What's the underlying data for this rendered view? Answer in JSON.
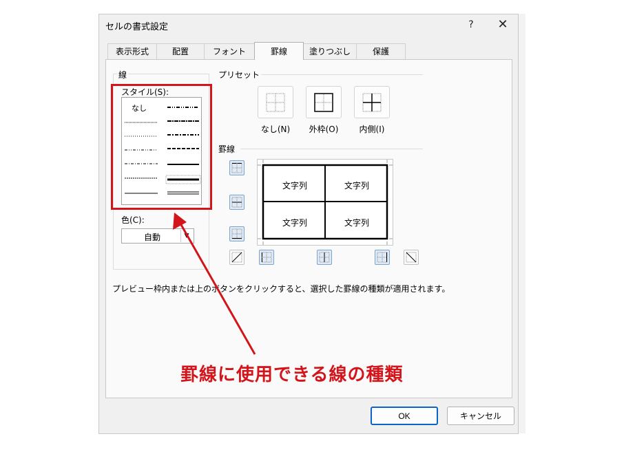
{
  "dialog": {
    "title": "セルの書式設定",
    "help": "?",
    "close": "✕"
  },
  "tabs": [
    {
      "label": "表示形式"
    },
    {
      "label": "配置"
    },
    {
      "label": "フォント"
    },
    {
      "label": "罫線",
      "active": true
    },
    {
      "label": "塗りつぶし"
    },
    {
      "label": "保護"
    }
  ],
  "line_group": {
    "title": "線",
    "style_label": "スタイル(S):",
    "none_style": "なし",
    "color_label": "色(C):",
    "color_value": "自動"
  },
  "presets": {
    "title": "プリセット",
    "none_label": "なし(N)",
    "outline_label": "外枠(O)",
    "inside_label": "内側(I)"
  },
  "border": {
    "title": "罫線",
    "cells": [
      "文字列",
      "文字列",
      "文字列",
      "文字列"
    ]
  },
  "instruction": "プレビュー枠内または上のボタンをクリックすると、選択した罫線の種類が適用されます。",
  "annotation": "罫線に使用できる線の種類",
  "buttons": {
    "ok": "OK",
    "cancel": "キャンセル"
  },
  "colors": {
    "annotation_red": "#d3141a",
    "selected_button_bg": "#dfeaf6",
    "ok_border": "#0a64c8"
  }
}
